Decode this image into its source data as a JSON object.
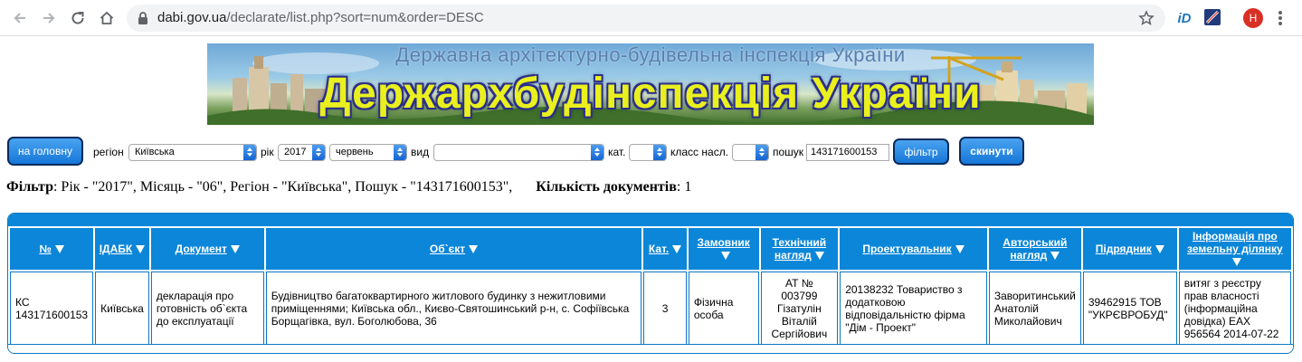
{
  "browser": {
    "url_domain": "dabi.gov.ua",
    "url_path": "/declarate/list.php?sort=num&order=DESC",
    "ext_id_label": "iD",
    "avatar_letter": "H"
  },
  "banner": {
    "subtitle": "Державна архітектурно-будівельна інспекція України",
    "title": "Держархбудінспекція України"
  },
  "filters": {
    "home_button": "на головну",
    "region_label": "регіон",
    "region_value": "Київська",
    "year_label": "рік",
    "year_value": "2017",
    "month_value": "червень",
    "type_label": "вид",
    "type_value": "",
    "category_label": "кат.",
    "category_value": "",
    "class_label": "класс насл.",
    "class_value": "",
    "search_label": "пошук",
    "search_value": "143171600153",
    "filter_button": "фільтр",
    "reset_button": "скинути"
  },
  "summary": {
    "filter_label": "Фільтр",
    "filter_text": ": Рік - \"2017\", Місяць - \"06\", Регіон - \"Київська\", Пошук - \"143171600153\",",
    "count_label": "Кількість документів",
    "count_value": ": 1"
  },
  "table": {
    "headers": [
      "№",
      "ІДАБК",
      "Документ",
      "Об`єкт",
      "Кат.",
      "Замовник",
      "Технічний нагляд",
      "Проектувальник",
      "Авторський нагляд",
      "Підрядник",
      "Інформація про земельну ділянку"
    ],
    "rows": [
      [
        "КС 143171600153",
        "Київська",
        "декларація про готовність об`єкта до експлуатації",
        "Будівництво багатоквартирного житлового будинку з нежитловими приміщеннями; Київська обл., Києво-Святошинський р-н, с. Софіївська Борщагівка, вул. Боголюбова, 36",
        "3",
        "Фізична особа",
        "АТ № 003799 Гізатулін Віталій Сергійович",
        "20138232 Товариство з додатковою відповідальністю фірма \"Дім - Проект\"",
        "Заворитинський Анатолій Миколайович",
        "39462915 ТОВ \"УКРЄВРОБУД\"",
        "витяг з реєстру прав власності (інформаційна довідка) EAX 956564 2014-07-22"
      ]
    ]
  }
}
